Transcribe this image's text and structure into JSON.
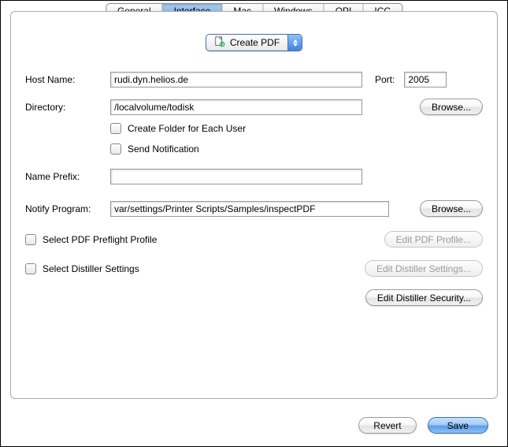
{
  "tabs": {
    "general": "General",
    "interface": "Interface",
    "mac": "Mac",
    "windows": "Windows",
    "opi": "OPI",
    "icc": "ICC"
  },
  "popup": {
    "selected": "Create PDF"
  },
  "hostname": {
    "label": "Host Name:",
    "value": "rudi.dyn.helios.de",
    "port_label": "Port:",
    "port_value": "2005"
  },
  "directory": {
    "label": "Directory:",
    "value": "/localvolume/todisk",
    "browse": "Browse..."
  },
  "checks": {
    "create_folder": "Create Folder for Each User",
    "send_notification": "Send Notification"
  },
  "prefix": {
    "label": "Name Prefix:",
    "value": ""
  },
  "notify": {
    "label": "Notify Program:",
    "value": "var/settings/Printer Scripts/Samples/inspectPDF",
    "browse": "Browse..."
  },
  "preflight": {
    "label": "Select PDF Preflight Profile",
    "button": "Edit PDF Profile..."
  },
  "distiller": {
    "label": "Select Distiller Settings",
    "settings_button": "Edit Distiller Settings...",
    "security_button": "Edit Distiller Security..."
  },
  "footer": {
    "revert": "Revert",
    "save": "Save"
  }
}
